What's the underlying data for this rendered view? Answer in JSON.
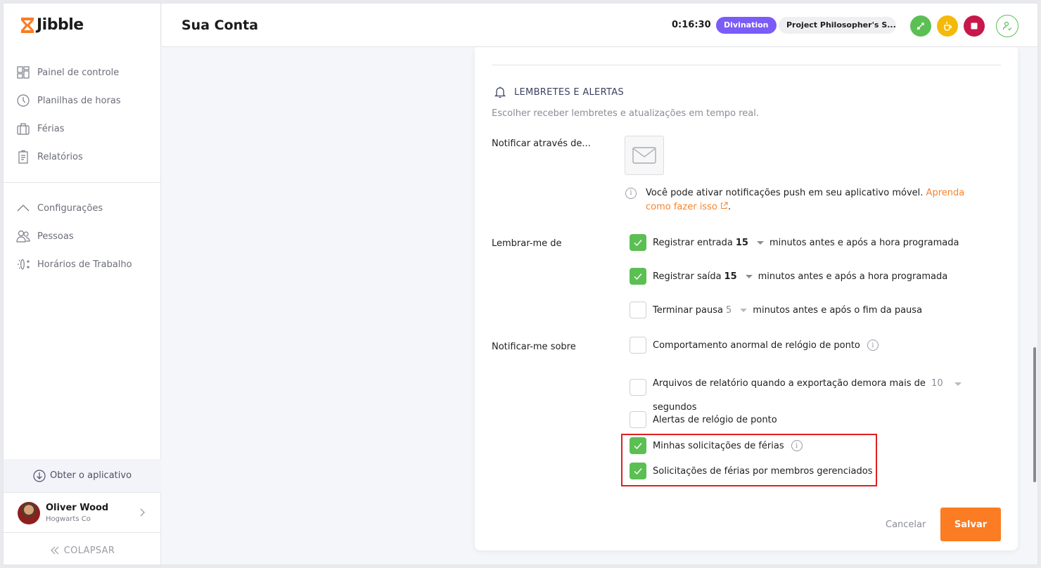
{
  "brand": {
    "name": "Jibble",
    "accent": "#fb7c22"
  },
  "sidebar": {
    "items": [
      {
        "label": "Painel de controle",
        "icon": "dashboard-icon"
      },
      {
        "label": "Planilhas de horas",
        "icon": "clock-icon"
      },
      {
        "label": "Férias",
        "icon": "suitcase-icon"
      },
      {
        "label": "Relatórios",
        "icon": "clipboard-icon"
      }
    ],
    "settings_group": {
      "label": "Configurações",
      "items": [
        {
          "label": "Pessoas",
          "icon": "people-icon"
        },
        {
          "label": "Horários de Trabalho",
          "icon": "schedule-icon"
        }
      ]
    },
    "get_app_label": "Obter o aplicativo",
    "user": {
      "name": "Oliver Wood",
      "org": "Hogwarts Co"
    },
    "collapse_label": "COLAPSAR"
  },
  "header": {
    "title": "Sua Conta",
    "timer": "0:16:30",
    "activity": {
      "label": "Divination",
      "color": "#7c5cf7"
    },
    "project": "Project Philosopher's S...",
    "buttons": [
      {
        "name": "switch-activity",
        "color": "#5bbf53"
      },
      {
        "name": "break",
        "color": "#f5b90b"
      },
      {
        "name": "stop",
        "color": "#c8174a"
      },
      {
        "name": "profile",
        "color": "#5bbf53"
      }
    ]
  },
  "section": {
    "title": "LEMBRETES E ALERTAS",
    "description": "Escolher receber lembretes e atualizações em tempo real.",
    "notify_via": {
      "label": "Notificar através de...",
      "push_note": "Você pode ativar notificações push em seu aplicativo móvel.",
      "push_link": "Aprenda como fazer isso",
      "push_link_suffix": "."
    },
    "remind_me": {
      "label": "Lembrar-me de",
      "items": [
        {
          "label": "Registrar entrada",
          "value": "15",
          "suffix": "minutos antes e após a hora programada",
          "checked": true
        },
        {
          "label": "Registrar saída",
          "value": "15",
          "suffix": "minutos antes e após a hora programada",
          "checked": true
        },
        {
          "label": "Terminar pausa",
          "value": "5",
          "suffix": "minutos antes e após o fim da pausa",
          "checked": false
        }
      ]
    },
    "notify_about": {
      "label": "Notificar-me sobre",
      "items": [
        {
          "label": "Comportamento anormal de relógio de ponto",
          "checked": false,
          "info": true
        },
        {
          "label": "Arquivos de relatório quando a exportação demora mais de",
          "value": "10",
          "suffix": "segundos",
          "checked": false
        },
        {
          "label": "Alertas de relógio de ponto",
          "checked": false
        },
        {
          "label": "Minhas solicitações de férias",
          "checked": true,
          "info": true
        },
        {
          "label": "Solicitações de férias por membros gerenciados",
          "checked": true
        }
      ]
    }
  },
  "actions": {
    "cancel": "Cancelar",
    "save": "Salvar"
  }
}
